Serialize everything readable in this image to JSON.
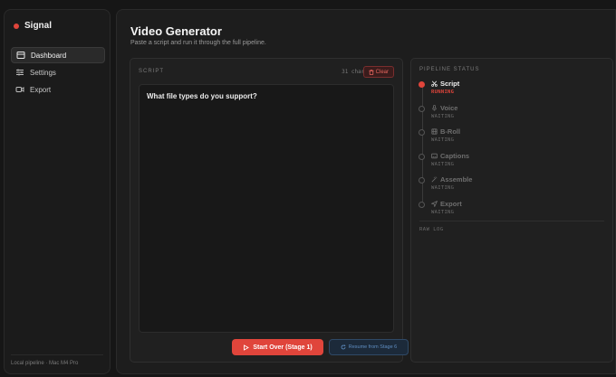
{
  "brand": {
    "name": "Signal",
    "dot_color": "#e0453b"
  },
  "nav": [
    {
      "label": "Dashboard",
      "icon": "dashboard-icon",
      "active": true
    },
    {
      "label": "Settings",
      "icon": "sliders-icon",
      "active": false
    },
    {
      "label": "Export",
      "icon": "video-icon",
      "active": false
    }
  ],
  "sidebar_footer": "Local pipeline · Mac M4 Pro",
  "header": {
    "title": "Video Generator",
    "subtitle": "Paste a script and run it through the full pipeline."
  },
  "script": {
    "label": "SCRIPT",
    "char_count": "31 chars",
    "clear_label": "Clear",
    "text": "What file types do you support?"
  },
  "actions": {
    "start_label": "Start Over (Stage 1)",
    "resume_label": "Resume from Stage 6"
  },
  "pipeline": {
    "label": "PIPELINE STATUS",
    "stages": [
      {
        "name": "Script",
        "icon": "scissors-icon",
        "status": "RUNNING",
        "active": true
      },
      {
        "name": "Voice",
        "icon": "mic-icon",
        "status": "WAITING",
        "active": false
      },
      {
        "name": "B-Roll",
        "icon": "film-icon",
        "status": "WAITING",
        "active": false
      },
      {
        "name": "Captions",
        "icon": "captions-icon",
        "status": "WAITING",
        "active": false
      },
      {
        "name": "Assemble",
        "icon": "wand-icon",
        "status": "WAITING",
        "active": false
      },
      {
        "name": "Export",
        "icon": "send-icon",
        "status": "WAITING",
        "active": false
      }
    ],
    "log_label": "RAW LOG"
  },
  "colors": {
    "accent": "#e0453b",
    "resume": "#5f8ec2"
  }
}
